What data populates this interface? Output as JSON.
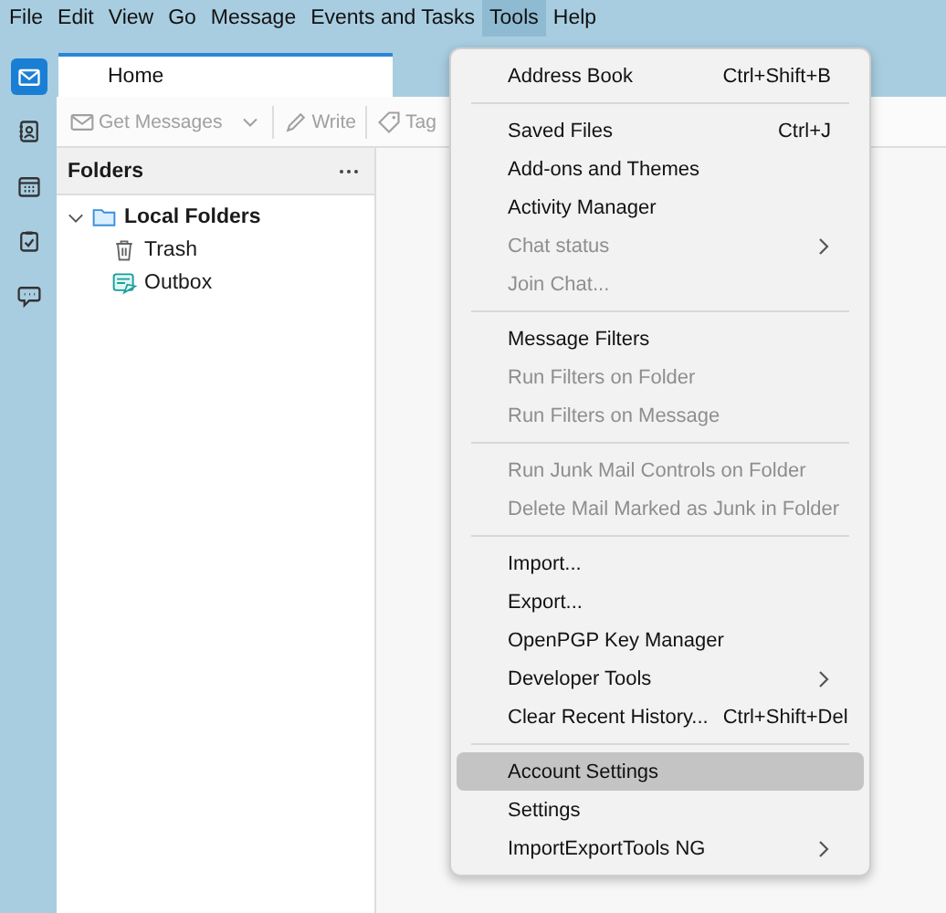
{
  "menubar": [
    {
      "label": "File",
      "selected": false
    },
    {
      "label": "Edit",
      "selected": false
    },
    {
      "label": "View",
      "selected": false
    },
    {
      "label": "Go",
      "selected": false
    },
    {
      "label": "Message",
      "selected": false
    },
    {
      "label": "Events and Tasks",
      "selected": false
    },
    {
      "label": "Tools",
      "selected": true
    },
    {
      "label": "Help",
      "selected": false
    }
  ],
  "spaces": [
    {
      "kind": "mail",
      "selected": true
    },
    {
      "kind": "address-book",
      "selected": false
    },
    {
      "kind": "calendar",
      "selected": false
    },
    {
      "kind": "tasks",
      "selected": false
    },
    {
      "kind": "chat",
      "selected": false
    }
  ],
  "tabs": [
    {
      "label": "Home",
      "selected": true
    }
  ],
  "toolbar": [
    {
      "kind": "get-messages",
      "label": "Get Messages",
      "disabled": true
    },
    {
      "kind": "dropdown",
      "disabled": true
    },
    {
      "kind": "write",
      "label": "Write",
      "disabled": true
    },
    {
      "kind": "tag",
      "label": "Tag",
      "disabled": true
    }
  ],
  "folder_pane": {
    "title": "Folders",
    "folders": [
      {
        "name": "Local Folders",
        "kind": "local",
        "expanded": true,
        "children": [
          {
            "name": "Trash",
            "kind": "trash"
          },
          {
            "name": "Outbox",
            "kind": "outbox"
          }
        ]
      }
    ]
  },
  "tools_menu": [
    {
      "kind": "item",
      "label": "Address Book",
      "shortcut": "Ctrl+Shift+B",
      "disabled": false,
      "submenu": false,
      "selected": false
    },
    {
      "kind": "separator"
    },
    {
      "kind": "item",
      "label": "Saved Files",
      "shortcut": "Ctrl+J",
      "disabled": false,
      "submenu": false,
      "selected": false
    },
    {
      "kind": "item",
      "label": "Add-ons and Themes",
      "disabled": false,
      "submenu": false,
      "selected": false
    },
    {
      "kind": "item",
      "label": "Activity Manager",
      "disabled": false,
      "submenu": false,
      "selected": false
    },
    {
      "kind": "item",
      "label": "Chat status",
      "disabled": true,
      "submenu": true,
      "selected": false
    },
    {
      "kind": "item",
      "label": "Join Chat...",
      "disabled": true,
      "submenu": false,
      "selected": false
    },
    {
      "kind": "separator"
    },
    {
      "kind": "item",
      "label": "Message Filters",
      "disabled": false,
      "submenu": false,
      "selected": false
    },
    {
      "kind": "item",
      "label": "Run Filters on Folder",
      "disabled": true,
      "submenu": false,
      "selected": false
    },
    {
      "kind": "item",
      "label": "Run Filters on Message",
      "disabled": true,
      "submenu": false,
      "selected": false
    },
    {
      "kind": "separator"
    },
    {
      "kind": "item",
      "label": "Run Junk Mail Controls on Folder",
      "disabled": true,
      "submenu": false,
      "selected": false
    },
    {
      "kind": "item",
      "label": "Delete Mail Marked as Junk in Folder",
      "disabled": true,
      "submenu": false,
      "selected": false
    },
    {
      "kind": "separator"
    },
    {
      "kind": "item",
      "label": "Import...",
      "disabled": false,
      "submenu": false,
      "selected": false
    },
    {
      "kind": "item",
      "label": "Export...",
      "disabled": false,
      "submenu": false,
      "selected": false
    },
    {
      "kind": "item",
      "label": "OpenPGP Key Manager",
      "disabled": false,
      "submenu": false,
      "selected": false
    },
    {
      "kind": "item",
      "label": "Developer Tools",
      "disabled": false,
      "submenu": true,
      "selected": false
    },
    {
      "kind": "item",
      "label": "Clear Recent History...",
      "shortcut": "Ctrl+Shift+Del",
      "disabled": false,
      "submenu": false,
      "selected": false
    },
    {
      "kind": "separator"
    },
    {
      "kind": "item",
      "label": "Account Settings",
      "disabled": false,
      "submenu": false,
      "selected": true
    },
    {
      "kind": "item",
      "label": "Settings",
      "disabled": false,
      "submenu": false,
      "selected": false
    },
    {
      "kind": "item",
      "label": "ImportExportTools NG",
      "disabled": false,
      "submenu": true,
      "selected": false
    }
  ]
}
